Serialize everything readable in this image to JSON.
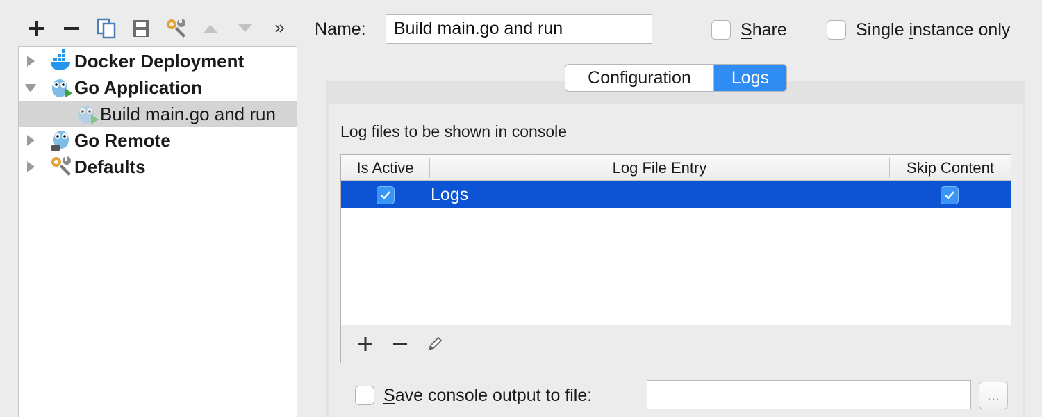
{
  "toolbar": {
    "buttons": [
      {
        "name": "add",
        "icon": "plus-icon",
        "enabled": true
      },
      {
        "name": "remove",
        "icon": "minus-icon",
        "enabled": true
      },
      {
        "name": "copy",
        "icon": "copy-icon",
        "enabled": true
      },
      {
        "name": "save",
        "icon": "save-icon",
        "enabled": true
      },
      {
        "name": "edit-defaults",
        "icon": "wrench-icon",
        "enabled": true
      },
      {
        "name": "move-up",
        "icon": "arrow-up-icon",
        "enabled": false
      },
      {
        "name": "move-down",
        "icon": "arrow-down-icon",
        "enabled": false
      },
      {
        "name": "more",
        "icon": "double-chevron-right-icon",
        "enabled": true
      }
    ]
  },
  "tree": {
    "items": [
      {
        "label": "Docker Deployment",
        "expanded": false,
        "level": 0,
        "icon": "docker-icon",
        "selected": false
      },
      {
        "label": "Go Application",
        "expanded": true,
        "level": 0,
        "icon": "gopher-run-icon",
        "selected": false
      },
      {
        "label": "Build main.go and run",
        "level": 1,
        "icon": "gopher-run-icon",
        "selected": true
      },
      {
        "label": "Go Remote",
        "expanded": false,
        "level": 0,
        "icon": "gopher-remote-icon",
        "selected": false
      },
      {
        "label": "Defaults",
        "expanded": false,
        "level": 0,
        "icon": "wrench-icon",
        "selected": false
      }
    ]
  },
  "config": {
    "name_label": "Name:",
    "name_value": "Build main.go and run",
    "share_label_u": "S",
    "share_label_rest": "hare",
    "share_checked": false,
    "single_label_pre": "Single ",
    "single_label_u": "i",
    "single_label_rest": "nstance only",
    "single_checked": false
  },
  "tabs": [
    {
      "label": "Configuration",
      "active": false
    },
    {
      "label": "Logs",
      "active": true
    }
  ],
  "logs": {
    "section_title": "Log files to be shown in console",
    "columns": [
      "Is Active",
      "Log File Entry",
      "Skip Content"
    ],
    "rows": [
      {
        "is_active": true,
        "entry": "Logs",
        "skip_content": true,
        "selected": true
      }
    ],
    "footer_buttons": [
      "plus-icon",
      "minus-icon",
      "pencil-icon"
    ]
  },
  "save_console": {
    "label_u": "S",
    "label_rest": "ave console output to file:",
    "checked": false,
    "path_value": "",
    "browse_label": "..."
  },
  "colors": {
    "selection": "#0c54d4",
    "tab_active": "#2f8cf3",
    "background": "#ececec"
  }
}
